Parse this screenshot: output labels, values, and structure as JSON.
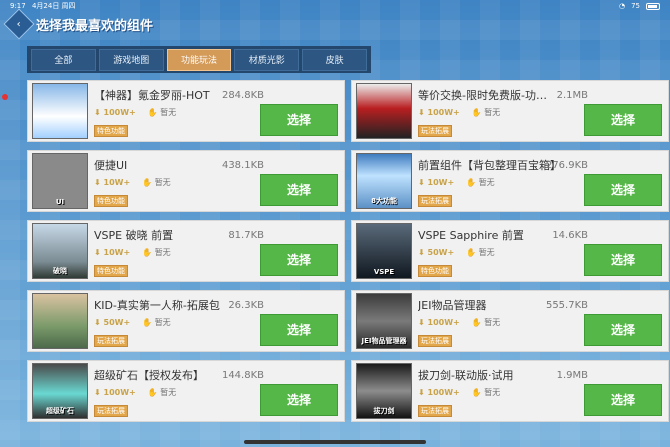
{
  "status": {
    "time": "9:17",
    "date": "4月24日 周四",
    "battery": "75"
  },
  "header": {
    "title": "选择我最喜欢的组件"
  },
  "tabs": [
    {
      "label": "全部"
    },
    {
      "label": "游戏地图"
    },
    {
      "label": "功能玩法",
      "active": true
    },
    {
      "label": "材质光影"
    },
    {
      "label": "皮肤"
    }
  ],
  "select_label": "选择",
  "rating_label": "暂无",
  "colors": {
    "accent_tab": "#d39a58",
    "select_button": "#55b748",
    "tag": "#e3a74b"
  },
  "items": [
    {
      "name": "【神器】氪金罗丽-HOT",
      "size": "284.8KB",
      "downloads": "100W+",
      "tag": "特色功能",
      "thumb_text": "",
      "thumb_bg": "linear-gradient(180deg,#87b7e8,#ffffff 60%,#a3d0ff)"
    },
    {
      "name": "等价交换-限时免费版-功…",
      "size": "2.1MB",
      "downloads": "100W+",
      "tag": "玩法拓展",
      "thumb_text": "",
      "thumb_bg": "linear-gradient(180deg,#ececec,#b91f21 45%,#222)"
    },
    {
      "name": "便捷UI",
      "size": "438.1KB",
      "downloads": "10W+",
      "tag": "特色功能",
      "thumb_text": "UI",
      "thumb_bg": "#8a8a8a"
    },
    {
      "name": "前置组件【背包整理百宝箱】",
      "size": "276.9KB",
      "downloads": "10W+",
      "tag": "玩法拓展",
      "thumb_text": "8大功能",
      "thumb_bg": "linear-gradient(180deg,#3e7bbf,#bfe2ff 40%,#5c91c6)"
    },
    {
      "name": "VSPE 破晓 前置",
      "size": "81.7KB",
      "downloads": "10W+",
      "tag": "特色功能",
      "thumb_text": "破晓",
      "thumb_bg": "linear-gradient(180deg,#c6d7e6,#7c8c93 70%,#2f3b34)"
    },
    {
      "name": "VSPE Sapphire 前置",
      "size": "14.6KB",
      "downloads": "50W+",
      "tag": "特色功能",
      "thumb_text": "VSPE",
      "thumb_bg": "linear-gradient(180deg,#5a6a7a,#101820)"
    },
    {
      "name": "KID-真实第一人称-拓展包",
      "size": "26.3KB",
      "downloads": "50W+",
      "tag": "玩法拓展",
      "thumb_text": "",
      "thumb_bg": "linear-gradient(180deg,#d9c2a0,#7a9a6a 60%,#4c6a4a)"
    },
    {
      "name": "JEI物品管理器",
      "size": "555.7KB",
      "downloads": "100W+",
      "tag": "玩法拓展",
      "thumb_text": "JEI物品管理器",
      "thumb_bg": "linear-gradient(180deg,#3c3c3c,#7a7a7a 50%,#2a2a2a)"
    },
    {
      "name": "超级矿石【授权发布】",
      "size": "144.8KB",
      "downloads": "100W+",
      "tag": "玩法拓展",
      "thumb_text": "超级矿石",
      "thumb_bg": "linear-gradient(180deg,#4a4a4a,#6ad8d2 55%,#2f2f2f)"
    },
    {
      "name": "拔刀剑-联动版·试用",
      "size": "1.9MB",
      "downloads": "100W+",
      "tag": "玩法拓展",
      "thumb_text": "拔刀剑",
      "thumb_bg": "linear-gradient(180deg,#1b1b1b,#8d8d8d 50%,#121212)"
    }
  ]
}
